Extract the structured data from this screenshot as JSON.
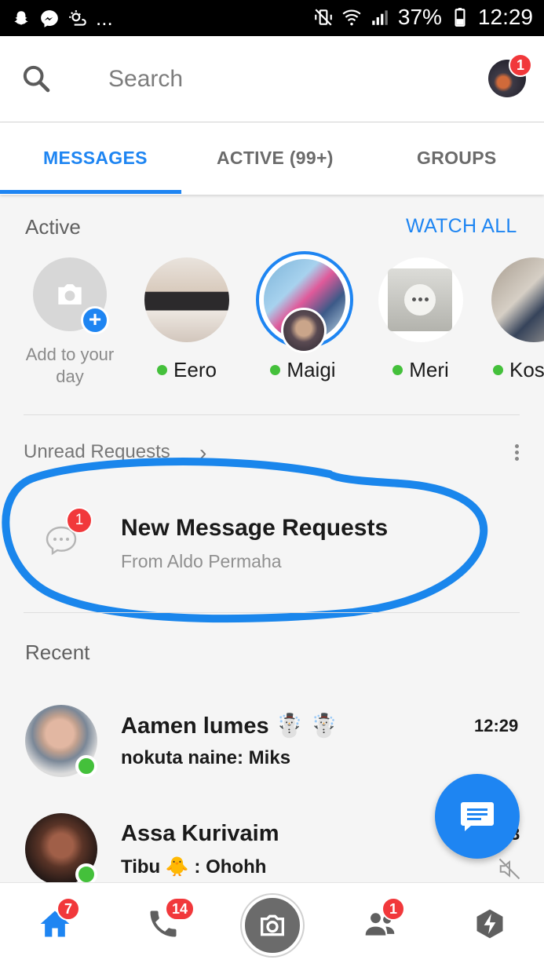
{
  "status_bar": {
    "battery": "37%",
    "time": "12:29",
    "more": "..."
  },
  "header": {
    "search_placeholder": "Search",
    "profile_badge": "1"
  },
  "tabs": [
    {
      "label": "MESSAGES",
      "active": true
    },
    {
      "label": "ACTIVE (99+)",
      "active": false
    },
    {
      "label": "GROUPS",
      "active": false
    }
  ],
  "active_section": {
    "title": "Active",
    "watch_all": "WATCH ALL",
    "add_to_day": "Add to your day",
    "people": [
      {
        "name": "Eero",
        "online": true
      },
      {
        "name": "Maigi",
        "online": true
      },
      {
        "name": "Meri",
        "online": true
      },
      {
        "name": "Kos",
        "online": true
      }
    ]
  },
  "requests": {
    "header": "Unread Requests",
    "badge": "1",
    "title": "New Message Requests",
    "subtitle": "From Aldo Permaha"
  },
  "recent": {
    "title": "Recent",
    "conversations": [
      {
        "name": "Aamen lumes ☃️ ☃️",
        "message": "nokuta naine: Miks",
        "time": "12:29"
      },
      {
        "name": "Assa Kurivaim",
        "message": "Tibu 🐥 : Ohohh",
        "time": "3"
      }
    ]
  },
  "bottom_nav": {
    "home_badge": "7",
    "calls_badge": "14",
    "people_badge": "1"
  },
  "colors": {
    "accent": "#1e85f2",
    "badge": "#f1383b",
    "online": "#44c03b"
  }
}
